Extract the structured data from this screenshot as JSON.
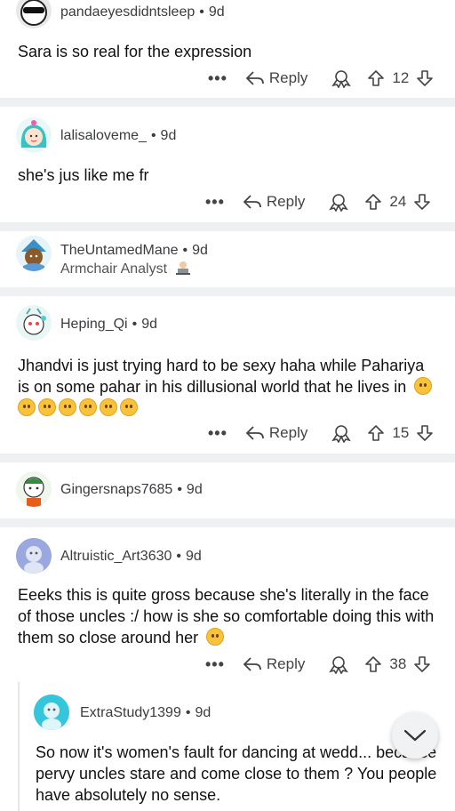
{
  "comments": [
    {
      "username": "pandaeyesdidntsleep",
      "age": "9d",
      "text": "Sara is so real for the expression",
      "reply": "Reply",
      "votes": "12"
    },
    {
      "username": "lalisaloveme_",
      "age": "9d",
      "text": "she's jus like me fr",
      "reply": "Reply",
      "votes": "24"
    },
    {
      "username": "TheUntamedMane",
      "age": "9d",
      "flair": "Armchair Analyst"
    },
    {
      "username": "Heping_Qi",
      "age": "9d",
      "text": "Jhandvi is just trying hard to be sexy haha while Pahariya is on some pahar in his dillusional world that he lives in",
      "reply": "Reply",
      "votes": "15"
    },
    {
      "username": "Gingersnaps7685",
      "age": "9d"
    },
    {
      "username": "Altruistic_Art3630",
      "age": "9d",
      "text": "Eeeks this is quite gross because she's literally in the face of those uncles :/ how is she so comfortable doing this with them so close around her",
      "reply": "Reply",
      "votes": "38"
    },
    {
      "username": "ExtraStudy1399",
      "age": "9d",
      "text": "So now it's women's fault for dancing at wedd... because pervy uncles stare and come close to them ? You people have absolutely no sense."
    }
  ],
  "more_label": "•••",
  "separator_dot": "•",
  "icons": {
    "reply": "reply-arrow-icon",
    "award": "award-icon",
    "upvote": "upvote-arrow-icon",
    "downvote": "downvote-arrow-icon",
    "collapse": "chevron-down-icon",
    "laptop": "laptop-emoji-icon"
  }
}
